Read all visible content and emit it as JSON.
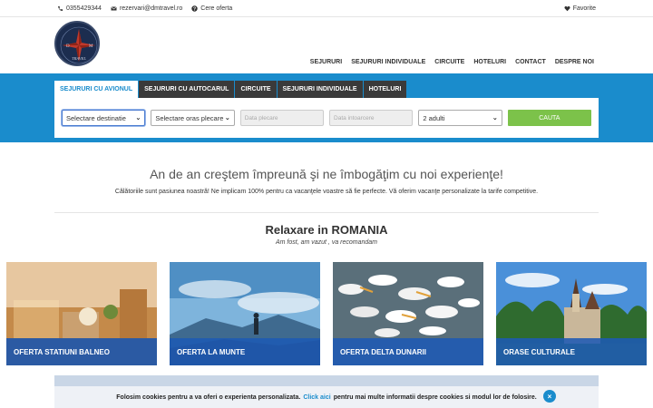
{
  "topbar": {
    "phone": "0355429344",
    "email": "rezervari@dmtravel.ro",
    "offer": "Cere oferta",
    "favorites": "Favorite"
  },
  "logo": {
    "letters_left": "D",
    "letters_right": "M",
    "text": "TRAVEL"
  },
  "nav": [
    "SEJURURI",
    "SEJURURI INDIVIDUALE",
    "CIRCUITE",
    "HOTELURI",
    "CONTACT",
    "DESPRE NOI"
  ],
  "tabs": [
    "SEJURURI CU AVIONUL",
    "SEJURURI CU AUTOCARUL",
    "CIRCUITE",
    "SEJURURI INDIVIDUALE",
    "HOTELURI"
  ],
  "search": {
    "destination": "Selectare destinatie",
    "departure_city": "Selectare oras plecare",
    "date_start_placeholder": "Data plecare",
    "date_return_placeholder": "Data intoarcere",
    "adults": "2 adulti",
    "button": "CAUTA"
  },
  "intro": {
    "heading": "An de an creştem împreună şi ne îmbogăţim cu noi experienţe!",
    "text": "Călătoriile sunt pasiunea noastră! Ne implicam 100% pentru ca vacanţele voastre să fie perfecte. Vă oferim vacanţe personalizate la tarife competitive."
  },
  "section": {
    "title": "Relaxare in ROMANIA",
    "subtitle": "Am fost, am vazut , va recomandam"
  },
  "cards": [
    "OFERTA STATIUNI BALNEO",
    "OFERTA LA MUNTE",
    "OFERTA DELTA DUNARII",
    "ORASE CULTURALE"
  ],
  "cookie": {
    "text_before": "Folosim cookies pentru a va oferi o experienta personalizata.",
    "link": "Click aici",
    "text_after": "pentru mai multe informatii despre cookies si modul lor de folosire.",
    "close": "×"
  },
  "colors": {
    "accent": "#1a8ccc",
    "button_green": "#7cc24a",
    "tab_dark": "#3a3a3a",
    "card_caption": "#1e5ab4"
  }
}
